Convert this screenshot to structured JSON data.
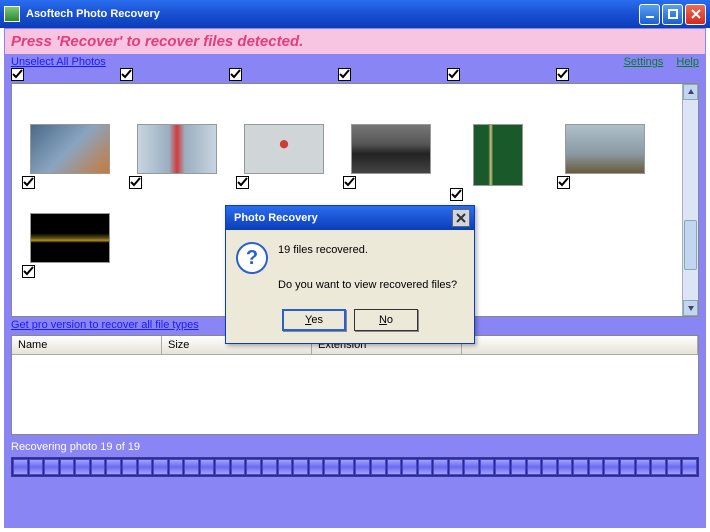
{
  "window": {
    "title": "Asoftech Photo Recovery"
  },
  "banner": "Press 'Recover' to recover files detected.",
  "links": {
    "unselect": "Unselect All Photos",
    "settings": "Settings",
    "help": "Help",
    "pro": "Get pro version to recover all file types"
  },
  "table": {
    "headers": {
      "name": "Name",
      "size": "Size",
      "ext": "Extension"
    }
  },
  "status": "Recovering photo 19 of 19",
  "dialog": {
    "title": "Photo Recovery",
    "line1": "19 files recovered.",
    "line2": "Do you want to view recovered files?",
    "yes": "Yes",
    "no": "No",
    "yes_key": "Y",
    "no_key": "N"
  },
  "progress_segments": 44,
  "thumbnails": [
    {
      "kind": "street"
    },
    {
      "kind": "runner1"
    },
    {
      "kind": "runner2"
    },
    {
      "kind": "car"
    },
    {
      "kind": "man"
    },
    {
      "kind": "fence"
    },
    {
      "kind": "night"
    }
  ],
  "top_checks": 6
}
